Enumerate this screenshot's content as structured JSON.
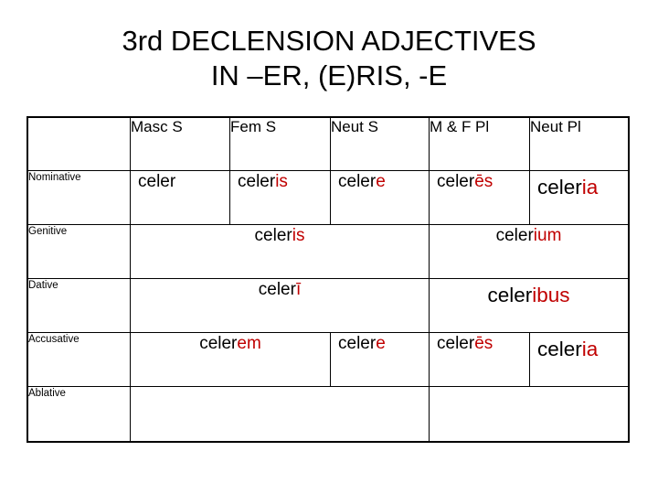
{
  "slide": {
    "title_line1": "3rd DECLENSION ADJECTIVES",
    "title_line2": "IN –ER, (E)RIS, -E",
    "accent_color": "#C00000",
    "text_color": "#000000",
    "background_color": "#FFFFFF"
  },
  "table": {
    "corner_label": "",
    "column_headers": [
      "Masc S",
      "Fem S",
      "Neut S",
      "M & F Pl",
      "Neut Pl"
    ],
    "row_labels": [
      "Nominative",
      "Genitive",
      "Dative",
      "Accusative",
      "Ablative"
    ],
    "rows": {
      "nominative": {
        "label": "Nominative",
        "masc_s_stem": "celer",
        "masc_s_ending": "",
        "fem_s_stem": "celer",
        "fem_s_ending": "is",
        "neut_s_stem": "celer",
        "neut_s_ending": "e",
        "mf_pl_stem": "celer",
        "mf_pl_ending": "ēs",
        "neut_pl_stem": "celer",
        "neut_pl_ending": "ia"
      },
      "genitive": {
        "label": "Genitive",
        "singular_stem": "celer",
        "singular_ending": "is",
        "plural_stem": "celer",
        "plural_ending": "ium"
      },
      "dative": {
        "label": "Dative",
        "singular_stem": "celer",
        "singular_ending": "ī",
        "plural_stem": "celer",
        "plural_ending": "ibus"
      },
      "accusative": {
        "label": "Accusative",
        "masc_fem_s_stem": "celer",
        "masc_fem_s_ending": "em",
        "neut_s_stem": "celer",
        "neut_s_ending": "e",
        "mf_pl_stem": "celer",
        "mf_pl_ending": "ēs",
        "neut_pl_stem": "celer",
        "neut_pl_ending": "ia"
      },
      "ablative": {
        "label": "Ablative",
        "singular_stem": "",
        "singular_ending": "",
        "plural_stem": "",
        "plural_ending": ""
      }
    }
  }
}
